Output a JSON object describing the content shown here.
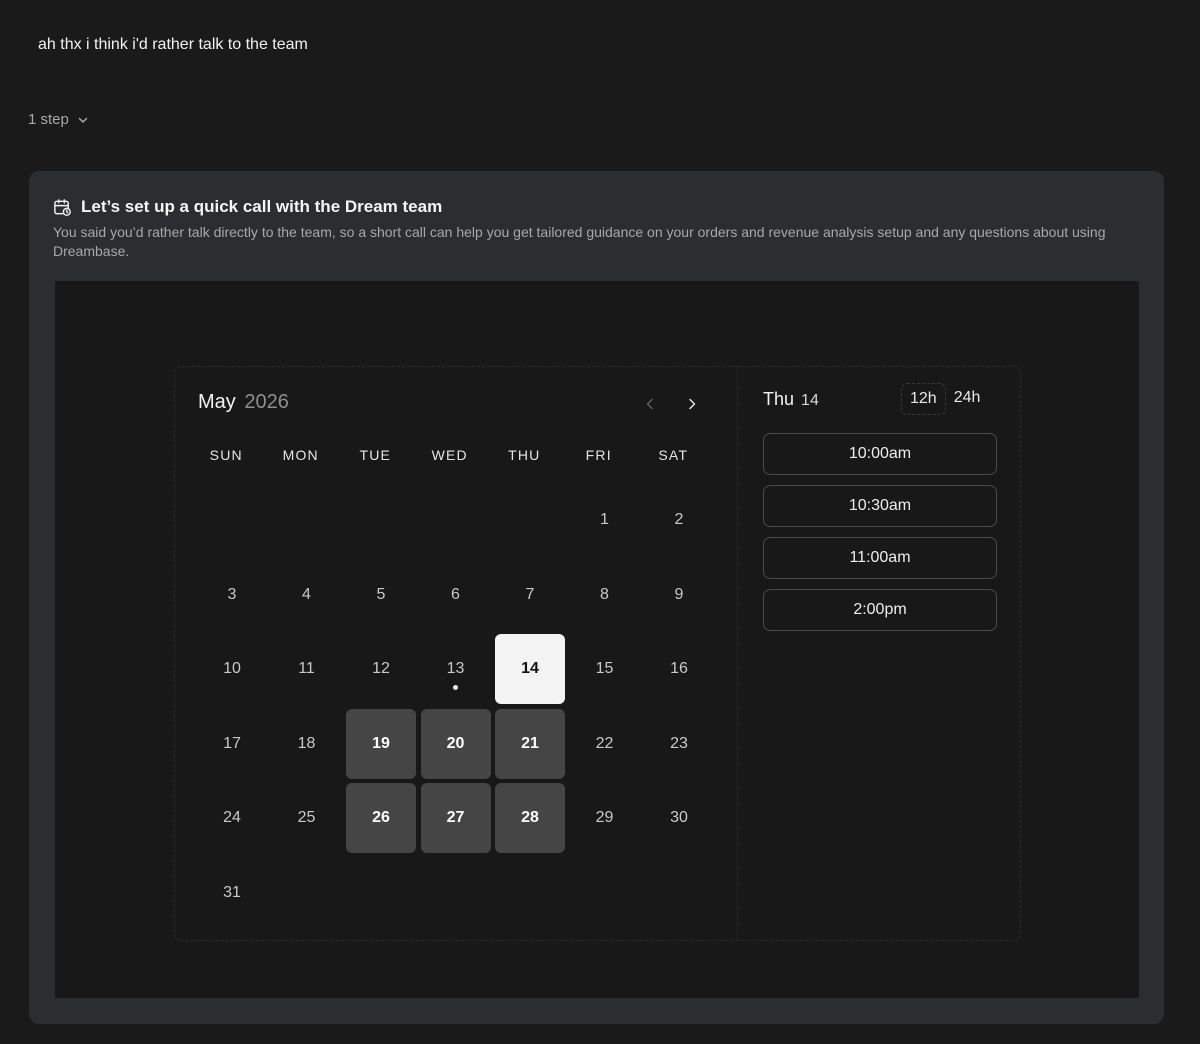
{
  "message": {
    "text": "ah thx i think i'd rather talk to the team"
  },
  "steps": {
    "label": "1 step",
    "icon": "chevron-down-icon"
  },
  "card": {
    "icon": "calendar-clock-icon",
    "title": "Let’s set up a quick call with the Dream team",
    "description": "You said you’d rather talk directly to the team, so a short call can help you get tailored guidance on your orders and revenue analysis setup and any questions about using Dreambase."
  },
  "booker": {
    "month": "May",
    "year": "2026",
    "weekdays": [
      "SUN",
      "MON",
      "TUE",
      "WED",
      "THU",
      "FRI",
      "SAT"
    ],
    "leading_blank_days": 5,
    "days": [
      "1",
      "2",
      "3",
      "4",
      "5",
      "6",
      "7",
      "8",
      "9",
      "10",
      "11",
      "12",
      "13",
      "14",
      "15",
      "16",
      "17",
      "18",
      "19",
      "20",
      "21",
      "22",
      "23",
      "24",
      "25",
      "26",
      "27",
      "28",
      "29",
      "30",
      "31"
    ],
    "today": "13",
    "selected_day": "14",
    "available_days": [
      "14",
      "19",
      "20",
      "21",
      "26",
      "27",
      "28"
    ],
    "selected_weekday": "Thu",
    "selected_date_num": "14",
    "time_formats": [
      "12h",
      "24h"
    ],
    "active_time_format": "12h",
    "slots": [
      "10:00am",
      "10:30am",
      "11:00am",
      "2:00pm"
    ],
    "colors": {
      "available_bg": "#454545",
      "selected_bg": "#f3f3f3"
    }
  }
}
